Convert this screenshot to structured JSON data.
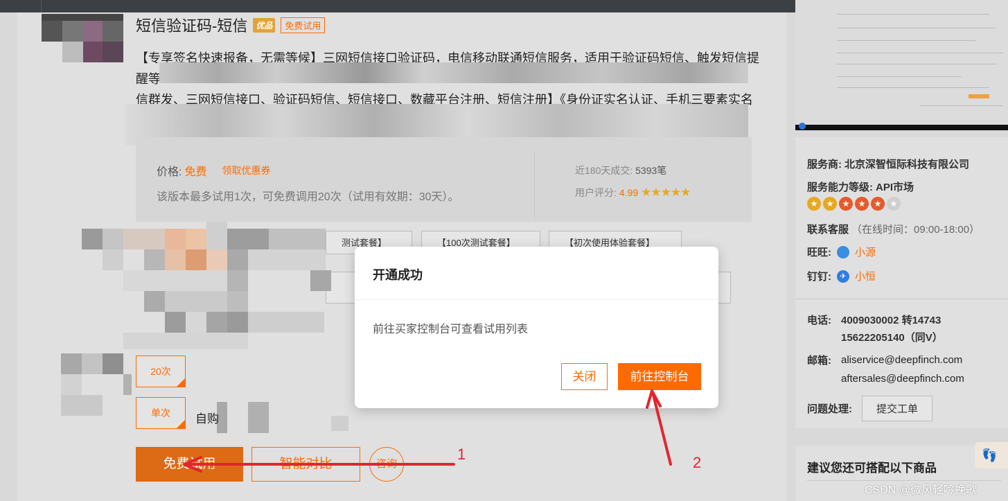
{
  "product": {
    "title": "短信验证码-短信",
    "badge_quality": "优品",
    "badge_trial": "免费试用",
    "desc_line1": "【专享签名快速报备，无需等候】三网短信接口验证码，电信移动联通短信服务，适用于验证码短信、触发短信提",
    "desc_line2": "醒等",
    "desc_line3": "信群发、三网短信接口、验证码短信、短信接口、数藏平台注册、短信注册】《身份证实名认证、手机三要素实名"
  },
  "price": {
    "label": "价格:",
    "value": "免费",
    "coupon": "领取优惠券",
    "trial_note": "该版本最多试用1次，可免费调用20次（试用有效期：30天）。",
    "sales_label": "近180天成交:",
    "sales_value": "5393笔",
    "rating_label": "用户评分:",
    "rating_value": "4.99"
  },
  "packages": [
    "测试套餐】",
    "【100次测试套餐】",
    "【初次使用体验套餐】"
  ],
  "quantity": {
    "option_20": "20次",
    "option_single": "单次",
    "self_buy": "自购"
  },
  "actions": {
    "trial": "免费试用",
    "compare": "智能对比",
    "consult": "咨询"
  },
  "seller": {
    "provider_label": "服务商:",
    "provider_value": "北京深智恒际科技有限公司",
    "level_label": "服务能力等级:",
    "level_value": "API市场",
    "level_crowns": 5,
    "cs_label": "联系客服",
    "cs_hours": "（在线时间：09:00-18:00）",
    "wangwang_label": "旺旺:",
    "wangwang_value": "小源",
    "dingding_label": "钉钉:",
    "dingding_value": "小恒",
    "phone_label": "电话:",
    "phone_1": "4009030002 转14743",
    "phone_2": "15622205140（同V）",
    "email_label": "邮箱:",
    "email_1": "aliservice@deepfinch.com",
    "email_2": "aftersales@deepfinch.com",
    "issue_label": "问题处理:",
    "ticket_button": "提交工单"
  },
  "recommend": {
    "title": "建议您还可搭配以下商品"
  },
  "modal": {
    "title": "开通成功",
    "body": "前往买家控制台可查看试用列表",
    "close": "关闭",
    "go_console": "前往控制台"
  },
  "annotations": {
    "arrow1_label": "1",
    "arrow2_label": "2",
    "color": "#e0262f"
  },
  "watermark": "CSDN @微风轻吟挽歌",
  "colors": {
    "accent": "#ff6a00",
    "star": "#e8a81f"
  }
}
